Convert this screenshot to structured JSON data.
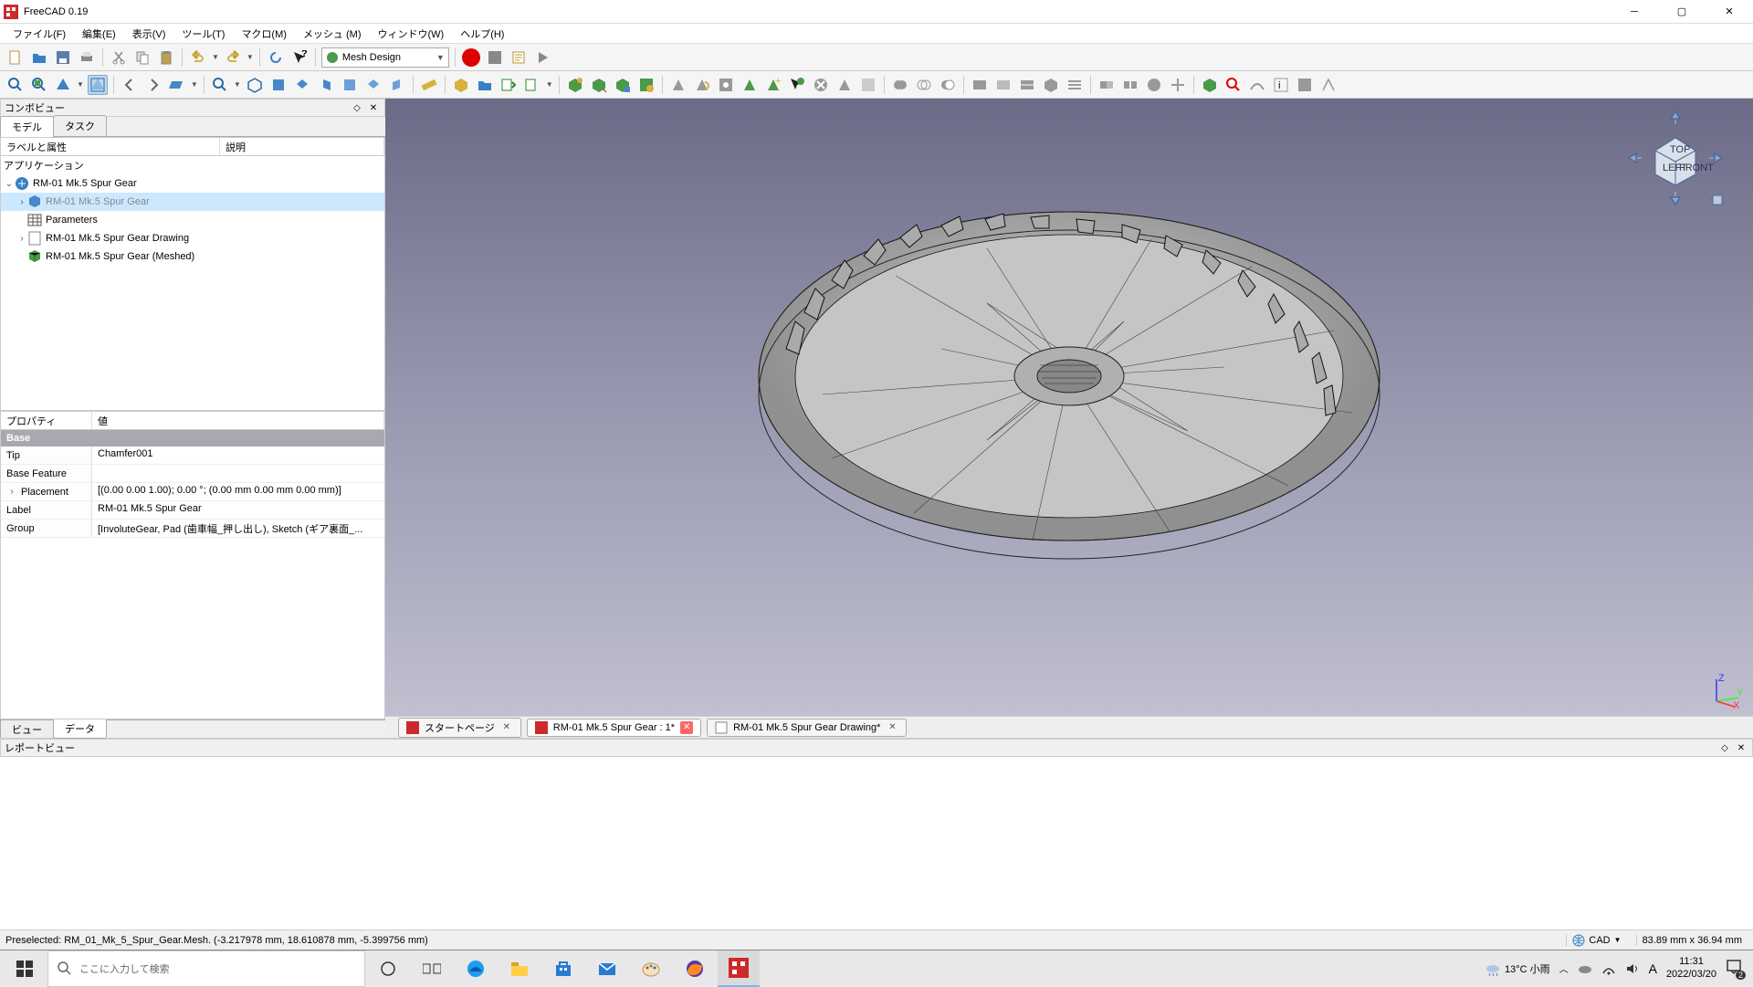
{
  "title": "FreeCAD 0.19",
  "menu": [
    "ファイル(F)",
    "編集(E)",
    "表示(V)",
    "ツール(T)",
    "マクロ(M)",
    "メッシュ (M)",
    "ウィンドウ(W)",
    "ヘルプ(H)"
  ],
  "workbench": "Mesh Design",
  "left": {
    "panel_title": "コンボビュー",
    "tabs": [
      "モデル",
      "タスク"
    ],
    "active_tab": 0,
    "tree_headers": [
      "ラベルと属性",
      "説明"
    ],
    "tree_app": "アプリケーション",
    "tree_root": "RM-01 Mk.5 Spur Gear",
    "tree": [
      {
        "label": "RM-01 Mk.5 Spur Gear",
        "selected": true,
        "expander": true,
        "kind": "body"
      },
      {
        "label": "Parameters",
        "expander": false,
        "kind": "sheet"
      },
      {
        "label": "RM-01 Mk.5 Spur Gear Drawing",
        "expander": true,
        "kind": "page"
      },
      {
        "label": "RM-01 Mk.5 Spur Gear (Meshed)",
        "expander": false,
        "kind": "mesh"
      }
    ],
    "prop_headers": [
      "プロパティ",
      "値"
    ],
    "prop_group": "Base",
    "props": [
      {
        "name": "Tip",
        "value": "Chamfer001"
      },
      {
        "name": "Base Feature",
        "value": ""
      },
      {
        "name": "Placement",
        "value": "[(0.00 0.00 1.00); 0.00 °; (0.00 mm  0.00 mm  0.00 mm)]",
        "expander": true
      },
      {
        "name": "Label",
        "value": "RM-01 Mk.5 Spur Gear"
      },
      {
        "name": "Group",
        "value": "[InvoluteGear, Pad (歯車幅_押し出し), Sketch (ギア裏面_..."
      }
    ],
    "bottom_tabs": [
      "ビュー",
      "データ"
    ],
    "bottom_active": 1
  },
  "doc_tabs": [
    {
      "label": "スタートページ",
      "close": "x"
    },
    {
      "label": "RM-01 Mk.5 Spur Gear : 1*",
      "close": "unsaved",
      "active": true
    },
    {
      "label": "RM-01 Mk.5 Spur Gear Drawing*",
      "close": "x"
    }
  ],
  "report_title": "レポートビュー",
  "status": {
    "left": "Preselected: RM_01_Mk_5_Spur_Gear.Mesh. (-3.217978 mm, 18.610878 mm, -5.399756 mm)",
    "mode": "CAD",
    "dims": "83.89 mm x 36.94 mm"
  },
  "taskbar": {
    "search_placeholder": "ここに入力して検索",
    "weather": "13°C 小雨",
    "time": "11:31",
    "date": "2022/03/20",
    "notif_count": "2"
  }
}
